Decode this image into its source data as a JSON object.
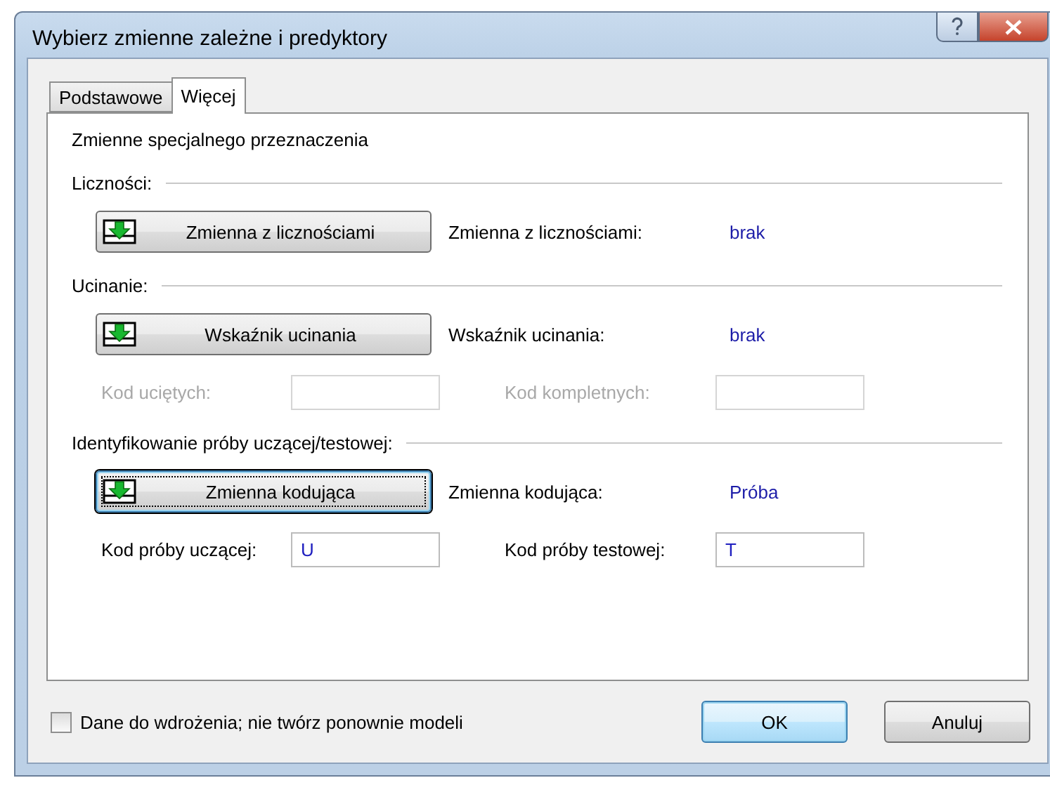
{
  "window": {
    "title": "Wybierz zmienne zależne i predyktory"
  },
  "tabs": [
    {
      "label": "Podstawowe",
      "selected": false
    },
    {
      "label": "Więcej",
      "selected": true
    }
  ],
  "panel_title": "Zmienne specjalnego przeznaczenia",
  "sections": [
    {
      "heading": "Liczności:",
      "button": {
        "label": "Zmienna z licznościami",
        "focused": false
      },
      "variable_label": "Zmienna z licznościami:",
      "variable_value": "brak"
    },
    {
      "heading": "Ucinanie:",
      "button": {
        "label": "Wskaźnik ucinania",
        "focused": false
      },
      "variable_label": "Wskaźnik ucinania:",
      "variable_value": "brak",
      "codes": [
        {
          "label": "Kod uciętych:",
          "disabled": true
        },
        {
          "label": "Kod kompletnych:",
          "disabled": true
        }
      ]
    },
    {
      "heading": "Identyfikowanie próby uczącej/testowej:",
      "button": {
        "label": "Zmienna kodująca",
        "focused": true
      },
      "variable_label": "Zmienna kodująca:",
      "variable_value": "Próba",
      "codes": [
        {
          "label": "Kod próby uczącej:",
          "value": "U",
          "disabled": false
        },
        {
          "label": "Kod próby testowej:",
          "value": "T",
          "disabled": false
        }
      ]
    }
  ],
  "checkbox": {
    "label": "Dane do wdrożenia; nie twórz ponownie modeli",
    "checked": false
  },
  "buttons": [
    {
      "label": "OK",
      "default": true
    },
    {
      "label": "Anuluj",
      "default": false
    }
  ]
}
